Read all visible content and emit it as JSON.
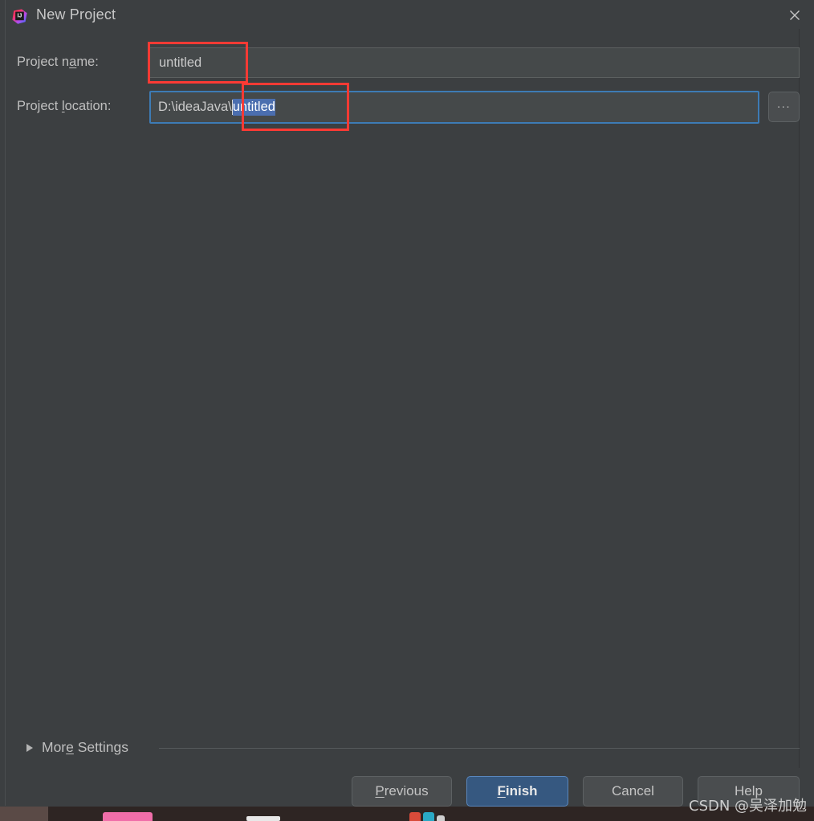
{
  "window": {
    "title": "New Project",
    "app_icon": "intellij-idea-logo",
    "close_icon": "close-icon"
  },
  "form": {
    "project_name": {
      "label_before": "Project n",
      "label_mnemonic": "a",
      "label_after": "me:",
      "value": "untitled"
    },
    "project_location": {
      "label_before": "Project ",
      "label_mnemonic": "l",
      "label_after": "ocation:",
      "value_prefix": "D:\\ideaJava\\",
      "value_selected": "untitled",
      "full_value": "D:\\ideaJava\\untitled"
    },
    "browse_button": {
      "label": "...",
      "icon": "ellipsis-icon"
    }
  },
  "more_settings": {
    "label_before": "Mor",
    "label_mnemonic": "e",
    "label_after": " Settings",
    "full_label": "More Settings",
    "expanded": false,
    "arrow_icon": "chevron-right-icon"
  },
  "buttons": {
    "previous": {
      "mnemonic": "P",
      "rest": "revious",
      "full": "Previous"
    },
    "finish": {
      "mnemonic": "F",
      "rest": "inish",
      "full": "Finish",
      "primary": true
    },
    "cancel": {
      "full": "Cancel"
    },
    "help": {
      "full": "Help"
    }
  },
  "watermark": {
    "text": "CSDN @吴泽加勉"
  },
  "colors": {
    "dialog_background": "#3c3f41",
    "input_background": "#45494a",
    "focus_border": "#3d7bb5",
    "selection_background": "#4b6eaf",
    "primary_button": "#365880",
    "annotation": "#fc3a34",
    "text": "#bfbfbf"
  }
}
